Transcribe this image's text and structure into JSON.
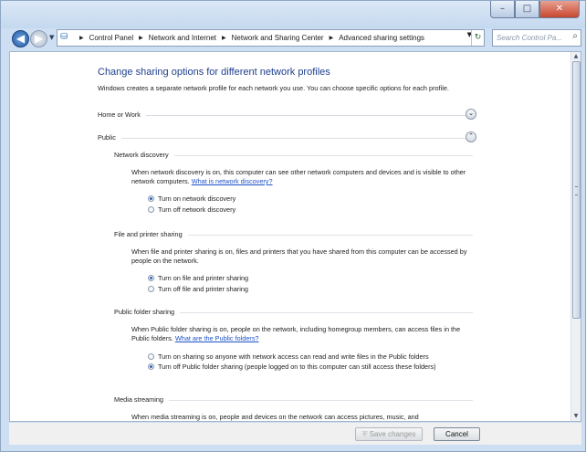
{
  "window": {
    "minimize_glyph": "–",
    "maximize_glyph": "□",
    "close_glyph": "✕"
  },
  "navigation": {
    "back_glyph": "◀",
    "forward_glyph": "▶",
    "breadcrumbs": [
      "Control Panel",
      "Network and Internet",
      "Network and Sharing Center",
      "Advanced sharing settings"
    ],
    "search_placeholder": "Search Control Pa...",
    "icons": [
      "back-arrow-icon",
      "forward-arrow-icon",
      "network-icon",
      "refresh-icon",
      "search-icon"
    ]
  },
  "page": {
    "heading": "Change sharing options for different network profiles",
    "intro": "Windows creates a separate network profile for each network you use. You can choose specific options for each profile.",
    "profiles": [
      {
        "label": "Home or Work",
        "state": "collapsed"
      },
      {
        "label": "Public",
        "state": "expanded"
      }
    ],
    "network_discovery": {
      "title": "Network discovery",
      "description": "When network discovery is on, this computer can see other network computers and devices and is visible to other network computers.",
      "link": "What is network discovery?",
      "options": [
        {
          "label": "Turn on network discovery",
          "selected": true
        },
        {
          "label": "Turn off network discovery",
          "selected": false
        }
      ]
    },
    "file_printer_sharing": {
      "title": "File and printer sharing",
      "description": "When file and printer sharing is on, files and printers that you have shared from this computer can be accessed by people on the network.",
      "options": [
        {
          "label": "Turn on file and printer sharing",
          "selected": true
        },
        {
          "label": "Turn off file and printer sharing",
          "selected": false
        }
      ]
    },
    "public_folder_sharing": {
      "title": "Public folder sharing",
      "description": "When Public folder sharing is on, people on the network, including homegroup members, can access files in the Public folders.",
      "link": "What are the Public folders?",
      "options": [
        {
          "label": "Turn on sharing so anyone with network access can read and write files in the Public folders",
          "selected": false
        },
        {
          "label": "Turn off Public folder sharing (people logged on to this computer can still access these folders)",
          "selected": true
        }
      ]
    },
    "media_streaming": {
      "title": "Media streaming",
      "description": "When media streaming is on, people and devices on the network can access pictures, music, and"
    }
  },
  "footer": {
    "save_label": "Save changes",
    "cancel_label": "Cancel"
  }
}
